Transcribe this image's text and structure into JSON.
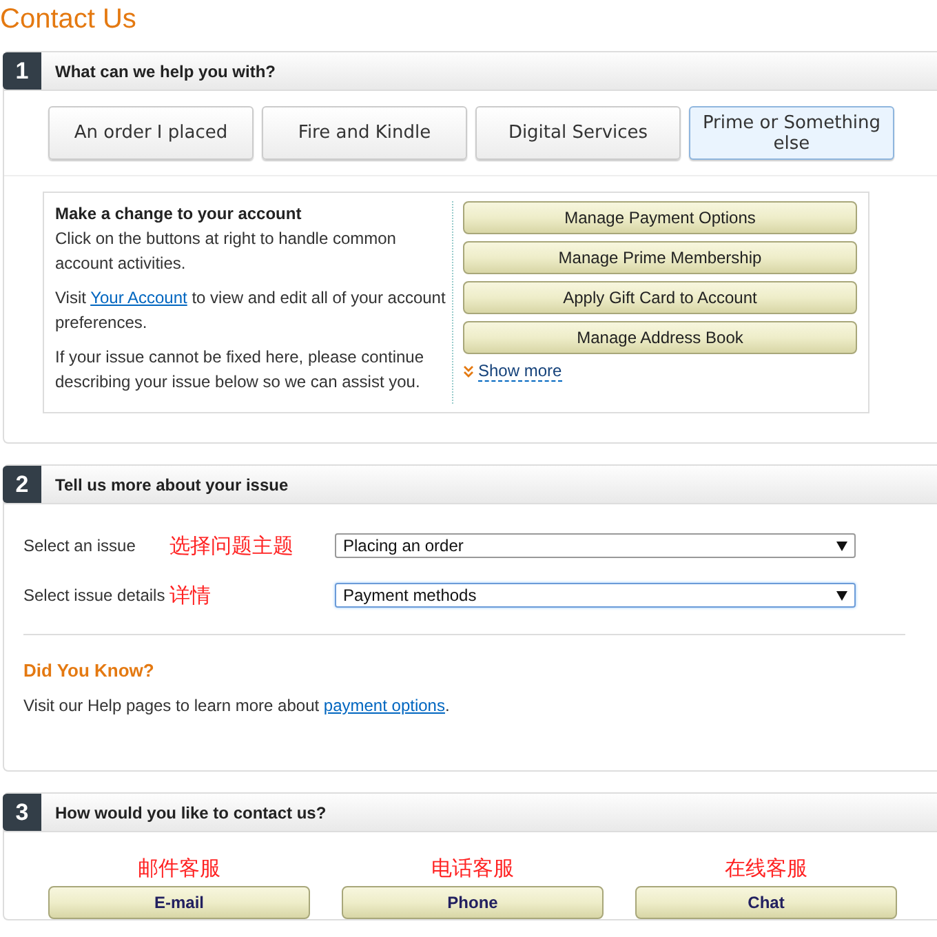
{
  "title": "Contact Us",
  "sections": [
    {
      "number": "1",
      "heading": "What can we help you with?"
    },
    {
      "number": "2",
      "heading": "Tell us more about your issue"
    },
    {
      "number": "3",
      "heading": "How would you like to contact us?"
    }
  ],
  "topics": [
    {
      "label": "An order I placed",
      "selected": false
    },
    {
      "label": "Fire and Kindle",
      "selected": false
    },
    {
      "label": "Digital Services",
      "selected": false
    },
    {
      "label": "Prime or Something else",
      "selected": true
    }
  ],
  "account_panel": {
    "heading": "Make a change to your account",
    "intro": "Click on the buttons at right to handle common account activities.",
    "visit_before": "Visit ",
    "visit_link": "Your Account",
    "visit_after": " to view and edit all of your account preferences.",
    "note": "If your issue cannot be fixed here, please continue describing your issue below so we can assist you.",
    "actions": [
      "Manage Payment Options",
      "Manage Prime Membership",
      "Apply Gift Card to Account",
      "Manage Address Book"
    ],
    "show_more": "Show more"
  },
  "issue_fields": [
    {
      "label": "Select an issue",
      "annotation": "选择问题主题",
      "value": "Placing an order",
      "focused": false
    },
    {
      "label": "Select issue details",
      "annotation": "详情",
      "value": "Payment methods",
      "focused": true
    }
  ],
  "did_you_know": {
    "heading": "Did You Know?",
    "text_before": "Visit our Help pages to learn more about ",
    "link": "payment options",
    "text_after": "."
  },
  "contact_options": [
    {
      "annotation": "邮件客服",
      "button": "E-mail"
    },
    {
      "annotation": "电话客服",
      "button": "Phone"
    },
    {
      "annotation": "在线客服",
      "button": "Chat"
    }
  ]
}
